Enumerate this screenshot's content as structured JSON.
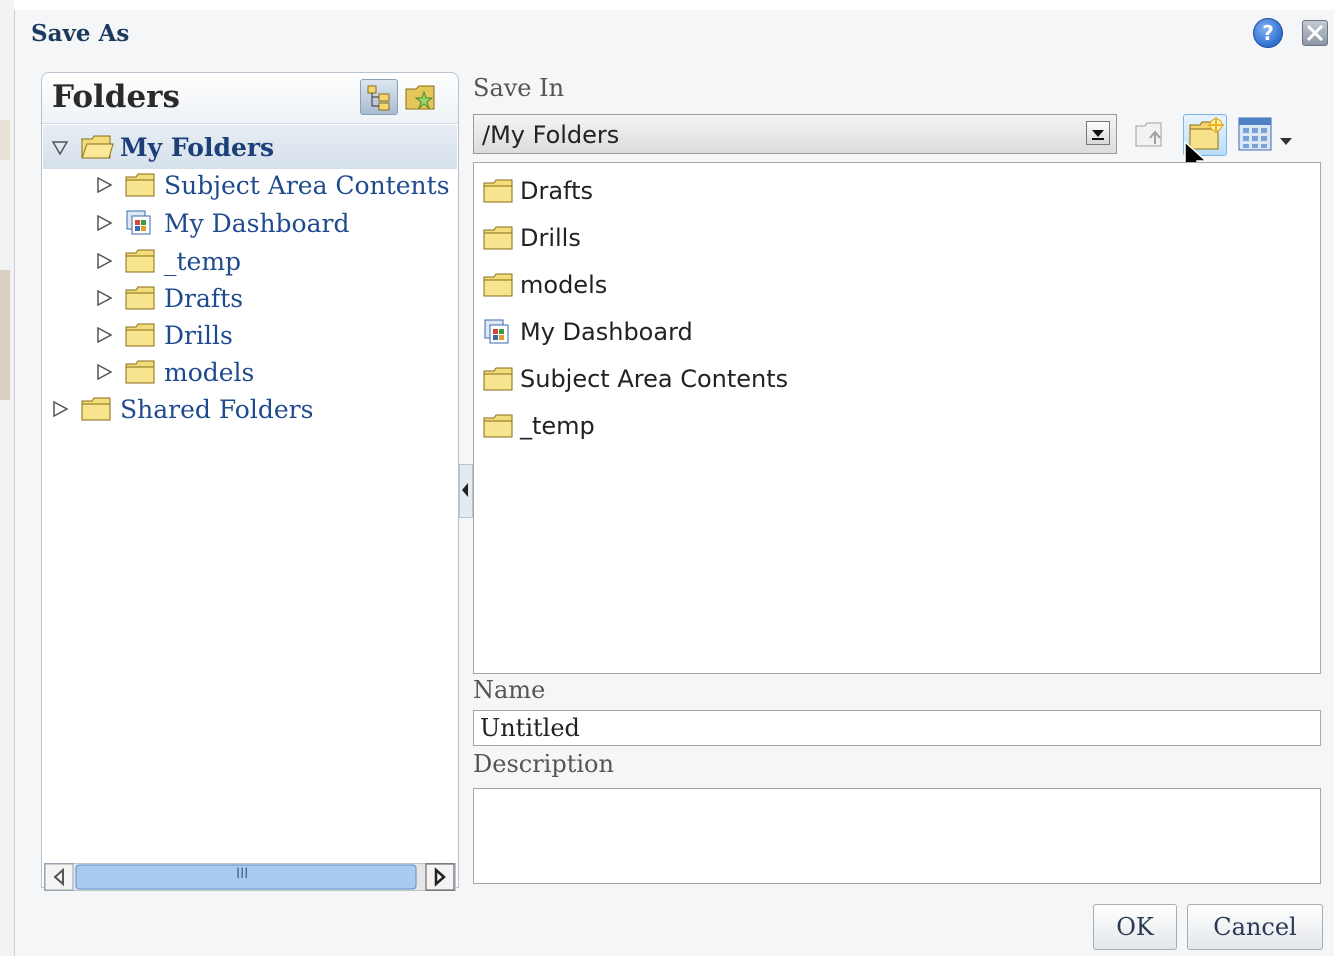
{
  "dialog": {
    "title": "Save As",
    "help_icon_text": "?"
  },
  "folders": {
    "title": "Folders",
    "tree": [
      {
        "label": "My Folders",
        "expanded": true,
        "selected": true,
        "icon": "open-folder-icon"
      },
      {
        "label": "Subject Area Contents",
        "icon": "folder-icon"
      },
      {
        "label": "My Dashboard",
        "icon": "dashboard-icon"
      },
      {
        "label": "_temp",
        "icon": "folder-icon"
      },
      {
        "label": "Drafts",
        "icon": "folder-icon"
      },
      {
        "label": "Drills",
        "icon": "folder-icon"
      },
      {
        "label": "models",
        "icon": "folder-icon"
      },
      {
        "label": "Shared Folders",
        "icon": "folder-icon"
      }
    ],
    "scroll_thumb_text": "III"
  },
  "save_in": {
    "label": "Save In",
    "path": "/My Folders"
  },
  "contents": [
    {
      "label": "Drafts",
      "icon": "folder-icon"
    },
    {
      "label": "Drills",
      "icon": "folder-icon"
    },
    {
      "label": "models",
      "icon": "folder-icon"
    },
    {
      "label": "My Dashboard",
      "icon": "dashboard-icon"
    },
    {
      "label": "Subject Area Contents",
      "icon": "folder-icon"
    },
    {
      "label": "_temp",
      "icon": "folder-icon"
    }
  ],
  "name": {
    "label": "Name",
    "value": "Untitled"
  },
  "description": {
    "label": "Description",
    "value": ""
  },
  "buttons": {
    "ok": "OK",
    "cancel": "Cancel"
  },
  "colors": {
    "link_blue": "#1f4b8e",
    "title_blue": "#1c3a5e",
    "folder_yellow": "#f3dc7a"
  }
}
